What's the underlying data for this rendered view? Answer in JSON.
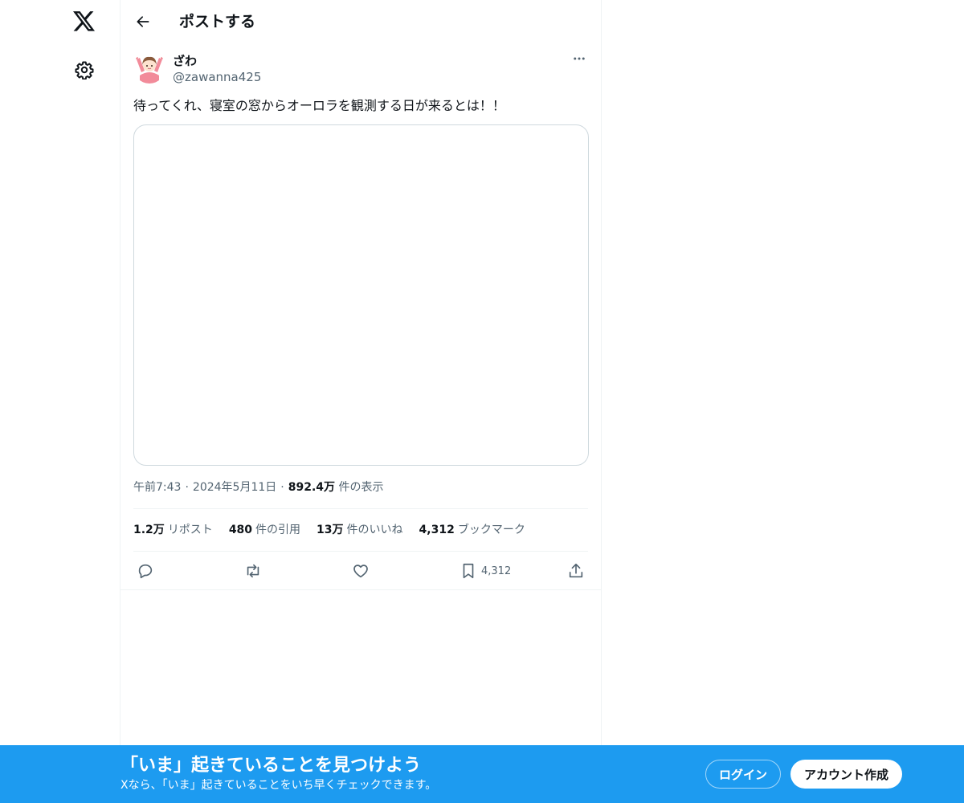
{
  "nav": {
    "logo_icon": "x-logo-icon",
    "settings_icon": "gear-icon"
  },
  "header": {
    "back_icon": "arrow-left-icon",
    "title": "ポストする"
  },
  "post": {
    "author_name": "ざわ",
    "author_handle": "@zawanna425",
    "text": "待ってくれ、寝室の窓からオーロラを観測する日が来るとは！！",
    "time": "午前7:43",
    "date": "2024年5月11日",
    "separator": "·",
    "views_count": "892.4万",
    "views_label": "件の表示",
    "stats": {
      "reposts_count": "1.2万",
      "reposts_label": "リポスト",
      "quotes_count": "480",
      "quotes_label": "件の引用",
      "likes_count": "13万",
      "likes_label": "件のいいね",
      "bookmarks_count": "4,312",
      "bookmarks_label": "ブックマーク"
    },
    "actions": {
      "bookmark_count": "4,312"
    }
  },
  "banner": {
    "title": "「いま」起きていることを見つけよう",
    "subtitle": "Xなら、「いま」起きていることをいち早くチェックできます。",
    "login_label": "ログイン",
    "signup_label": "アカウント作成"
  },
  "colors": {
    "accent": "#1d9bf0",
    "text_primary": "#0f1419",
    "text_secondary": "#536471",
    "border": "#eff3f4"
  }
}
